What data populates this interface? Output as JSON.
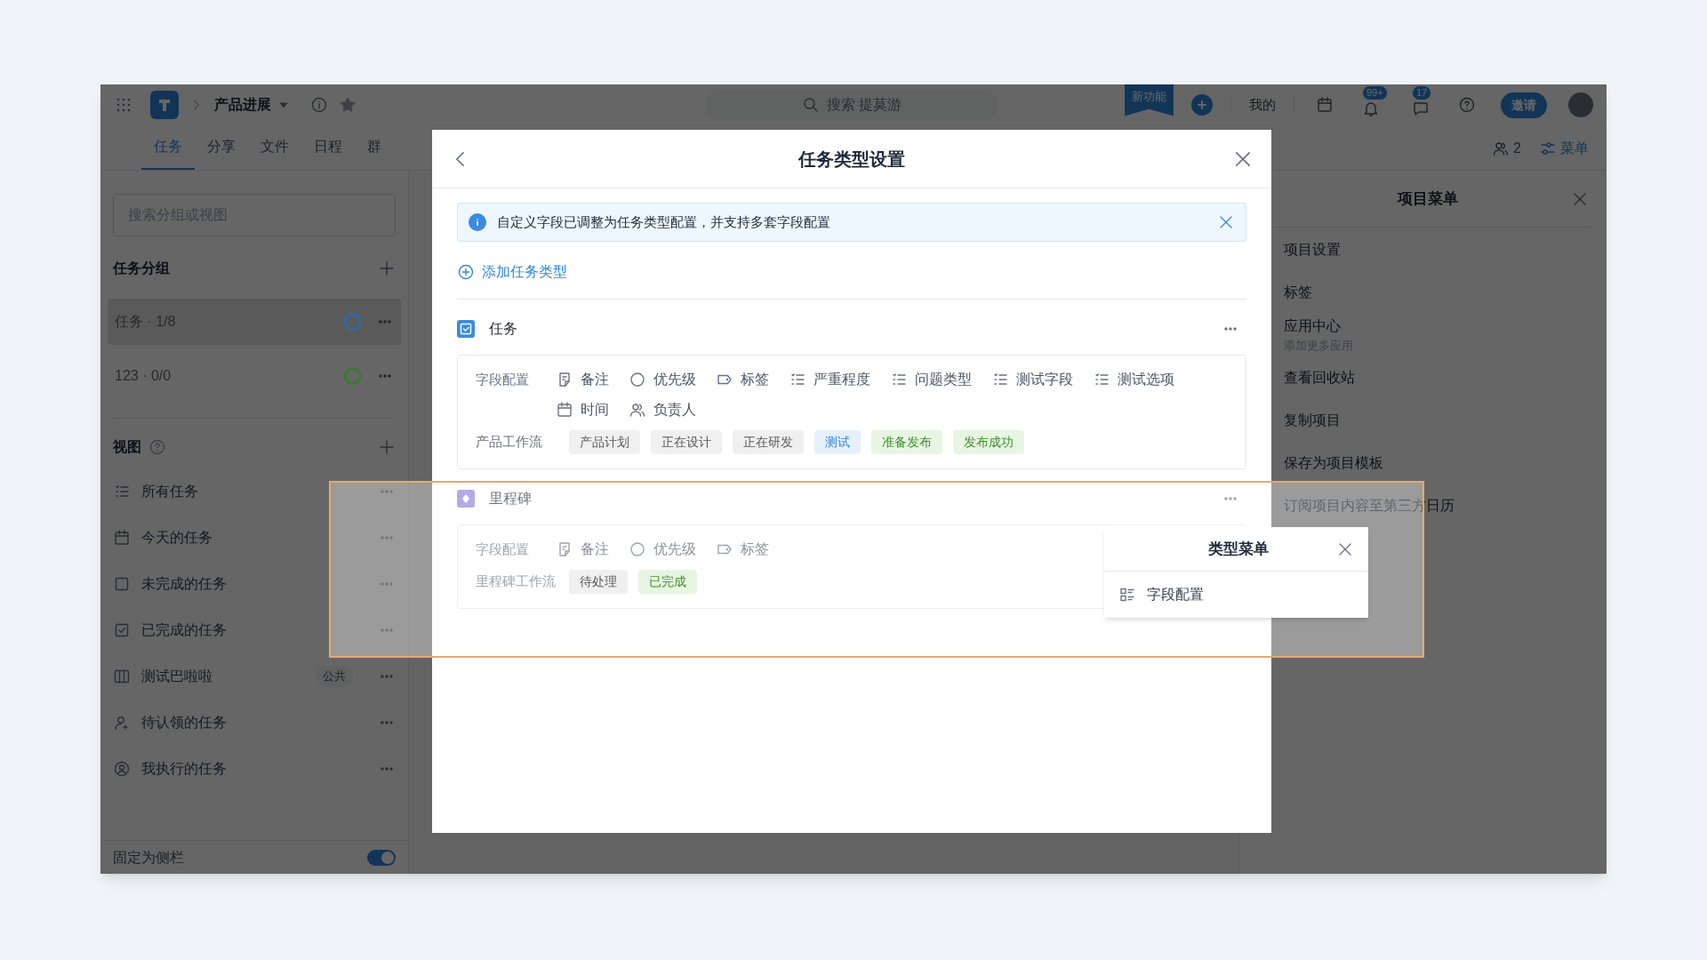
{
  "top_bar": {
    "project": "产品进展",
    "search": "搜索 提莫游",
    "new_feature": "新功能",
    "mine": "我的",
    "notifications": "99+",
    "messages": "17",
    "invite": "邀请"
  },
  "tabs": [
    {
      "label": "任务",
      "selected": true
    },
    {
      "label": "分享",
      "selected": false
    },
    {
      "label": "文件",
      "selected": false
    },
    {
      "label": "日程",
      "selected": false
    },
    {
      "label": "群",
      "selected": false
    }
  ],
  "members": "2",
  "menu_button": "菜单",
  "sidebar": {
    "search": {
      "placeholder": "搜索分组或视图"
    },
    "groups_title": "任务分组",
    "groups": [
      {
        "label": "任务 · 1/8",
        "selected": true,
        "color": "#2f6aa6"
      },
      {
        "label": "123 · 0/0",
        "selected": false,
        "color": "#3a7a30"
      }
    ],
    "views_title": "视图",
    "views": [
      {
        "kind": "list",
        "label": "所有任务"
      },
      {
        "kind": "calendar",
        "label": "今天的任务"
      },
      {
        "kind": "box",
        "label": "未完成的任务"
      },
      {
        "kind": "checked",
        "label": "已完成的任务"
      },
      {
        "kind": "columns",
        "label": "测试巴啦啦",
        "badge": "公共"
      },
      {
        "kind": "person",
        "label": "待认领的任务"
      },
      {
        "kind": "circle-person",
        "label": "我执行的任务"
      }
    ],
    "pin": {
      "label": "固定为侧栏",
      "on": true
    }
  },
  "project_menu": {
    "title": "项目菜单",
    "items": [
      {
        "label": "项目设置"
      },
      {
        "label": "标签"
      },
      {
        "label": "应用中心",
        "sub": "添加更多应用"
      },
      {
        "label": "查看回收站"
      },
      {
        "label": "复制项目"
      },
      {
        "label": "保存为项目模板"
      },
      {
        "label": "订阅项目内容至第三方日历"
      }
    ]
  },
  "dialog": {
    "title": "任务类型设置",
    "notice": "自定义字段已调整为任务类型配置，并支持多套字段配置",
    "add_type": "添加任务类型",
    "types": [
      {
        "kind": "task",
        "name": "任务",
        "fields_label": "字段配置",
        "fields": [
          {
            "kind": "note",
            "label": "备注"
          },
          {
            "kind": "circle",
            "label": "优先级"
          },
          {
            "kind": "tag",
            "label": "标签"
          },
          {
            "kind": "list",
            "label": "严重程度"
          },
          {
            "kind": "list",
            "label": "问题类型"
          },
          {
            "kind": "list",
            "label": "测试字段"
          },
          {
            "kind": "list",
            "label": "测试选项"
          },
          {
            "kind": "calendar",
            "label": "时间"
          },
          {
            "kind": "people",
            "label": "负责人"
          }
        ],
        "workflow_label": "产品工作流",
        "statuses": [
          {
            "label": "产品计划",
            "color": "#595959"
          },
          {
            "label": "正在设计",
            "color": "#595959"
          },
          {
            "label": "正在研发",
            "color": "#595959"
          },
          {
            "label": "测试",
            "color": "#2f7fd6"
          },
          {
            "label": "准备发布",
            "color": "#3f8f2f"
          },
          {
            "label": "发布成功",
            "color": "#3f8f2f"
          }
        ]
      },
      {
        "kind": "milestone",
        "name": "里程碑",
        "fields_label": "字段配置",
        "fields": [
          {
            "kind": "note",
            "label": "备注"
          },
          {
            "kind": "circle",
            "label": "优先级"
          },
          {
            "kind": "tag",
            "label": "标签"
          }
        ],
        "workflow_label": "里程碑工作流",
        "statuses": [
          {
            "label": "待处理",
            "color": "#595959"
          },
          {
            "label": "已完成",
            "color": "#3f8f2f"
          }
        ]
      }
    ]
  },
  "type_menu": {
    "title": "类型菜单",
    "items": [
      {
        "label": "字段配置"
      }
    ]
  }
}
